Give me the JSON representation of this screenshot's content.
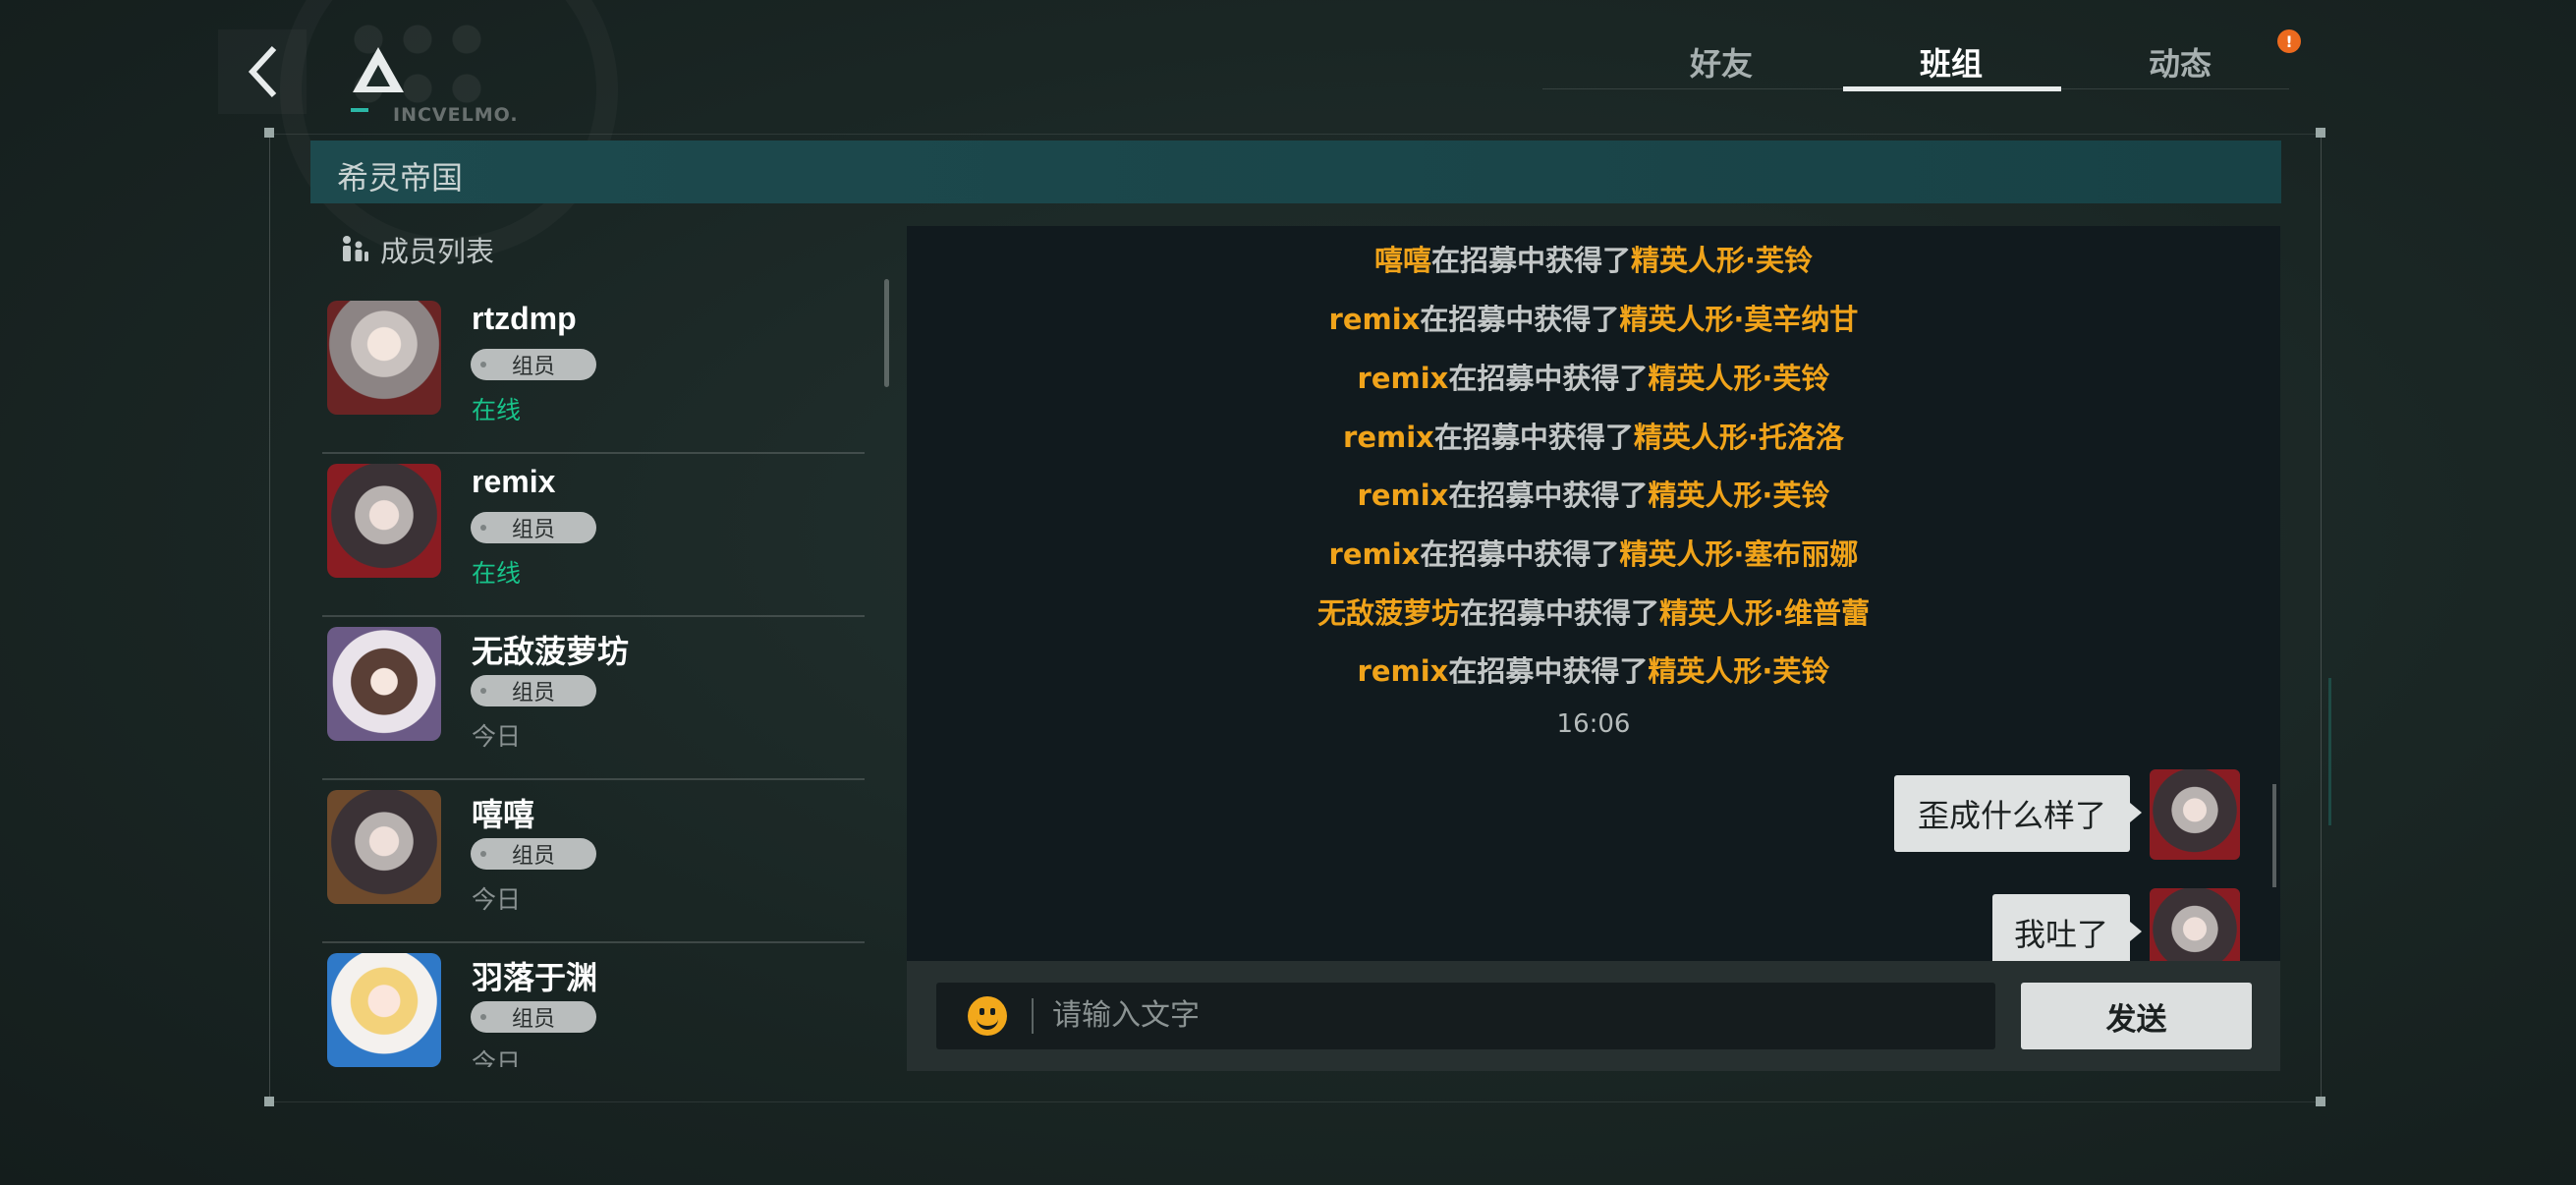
{
  "header": {
    "logo_text": "INCVELMO.",
    "tabs": [
      {
        "label": "好友",
        "active": false
      },
      {
        "label": "班组",
        "active": true
      },
      {
        "label": "动态",
        "active": false,
        "badge": "!"
      }
    ]
  },
  "group": {
    "name": "希灵帝国"
  },
  "members": {
    "heading": "成员列表",
    "items": [
      {
        "name": "rtzdmp",
        "role": "组员",
        "status": "在线",
        "online": true
      },
      {
        "name": "remix",
        "role": "组员",
        "status": "在线",
        "online": true
      },
      {
        "name": "无敌菠萝坊",
        "role": "组员",
        "status": "今日",
        "online": false
      },
      {
        "name": "嘻嘻",
        "role": "组员",
        "status": "今日",
        "online": false
      },
      {
        "name": "羽落于渊",
        "role": "组员",
        "status": "今日",
        "online": false
      }
    ]
  },
  "chat": {
    "system_messages": [
      {
        "player": "嘻嘻",
        "mid": "在招募中获得了",
        "item": "精英人形·芙铃"
      },
      {
        "player": "remix",
        "mid": "在招募中获得了",
        "item": "精英人形·莫辛纳甘"
      },
      {
        "player": "remix",
        "mid": "在招募中获得了",
        "item": "精英人形·芙铃"
      },
      {
        "player": "remix",
        "mid": "在招募中获得了",
        "item": "精英人形·托洛洛"
      },
      {
        "player": "remix",
        "mid": "在招募中获得了",
        "item": "精英人形·芙铃"
      },
      {
        "player": "remix",
        "mid": "在招募中获得了",
        "item": "精英人形·塞布丽娜"
      },
      {
        "player": "无敌菠萝坊",
        "mid": "在招募中获得了",
        "item": "精英人形·维普蕾"
      },
      {
        "player": "remix",
        "mid": "在招募中获得了",
        "item": "精英人形·芙铃"
      }
    ],
    "timestamp": "16:06",
    "my_messages": [
      {
        "text": "歪成什么样了"
      },
      {
        "text": "我吐了"
      }
    ]
  },
  "input": {
    "placeholder": "请输入文字",
    "send_label": "发送"
  },
  "colors": {
    "highlight": "#f0a31a",
    "online": "#18c38a",
    "accent": "#2bb7a6",
    "group_bar": "#1d4a4e"
  },
  "icons": [
    "back-arrow-icon",
    "logo-icon",
    "members-icon",
    "emoji-icon",
    "alert-icon"
  ]
}
